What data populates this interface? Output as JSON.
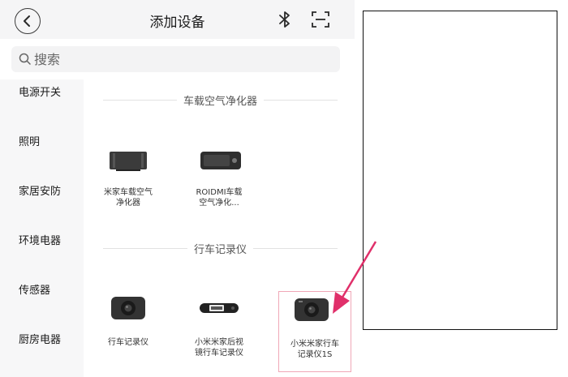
{
  "header": {
    "title": "添加设备",
    "back_icon": "chevron-left-icon",
    "bluetooth_icon": "bluetooth-icon",
    "scan_icon": "scan-icon"
  },
  "search": {
    "placeholder": "搜索",
    "value": ""
  },
  "sidebar": {
    "items": [
      {
        "label": "电源开关"
      },
      {
        "label": "照明"
      },
      {
        "label": "家居安防"
      },
      {
        "label": "环境电器"
      },
      {
        "label": "传感器"
      },
      {
        "label": "厨房电器"
      }
    ]
  },
  "sections": [
    {
      "title": "车载空气净化器",
      "devices": [
        {
          "name_line1": "米家车载空气",
          "name_line2": "净化器"
        },
        {
          "name_line1": "ROIDMI车载",
          "name_line2": "空气净化..."
        }
      ]
    },
    {
      "title": "行车记录仪",
      "devices": [
        {
          "name_line1": "行车记录仪",
          "name_line2": ""
        },
        {
          "name_line1": "小米米家后视",
          "name_line2": "镜行车记录仪"
        },
        {
          "name_line1": "小米米家行车",
          "name_line2": "记录仪1S"
        }
      ]
    }
  ],
  "colors": {
    "highlight_border": "#f0a7b7",
    "annotation_arrow": "#e0306a"
  }
}
